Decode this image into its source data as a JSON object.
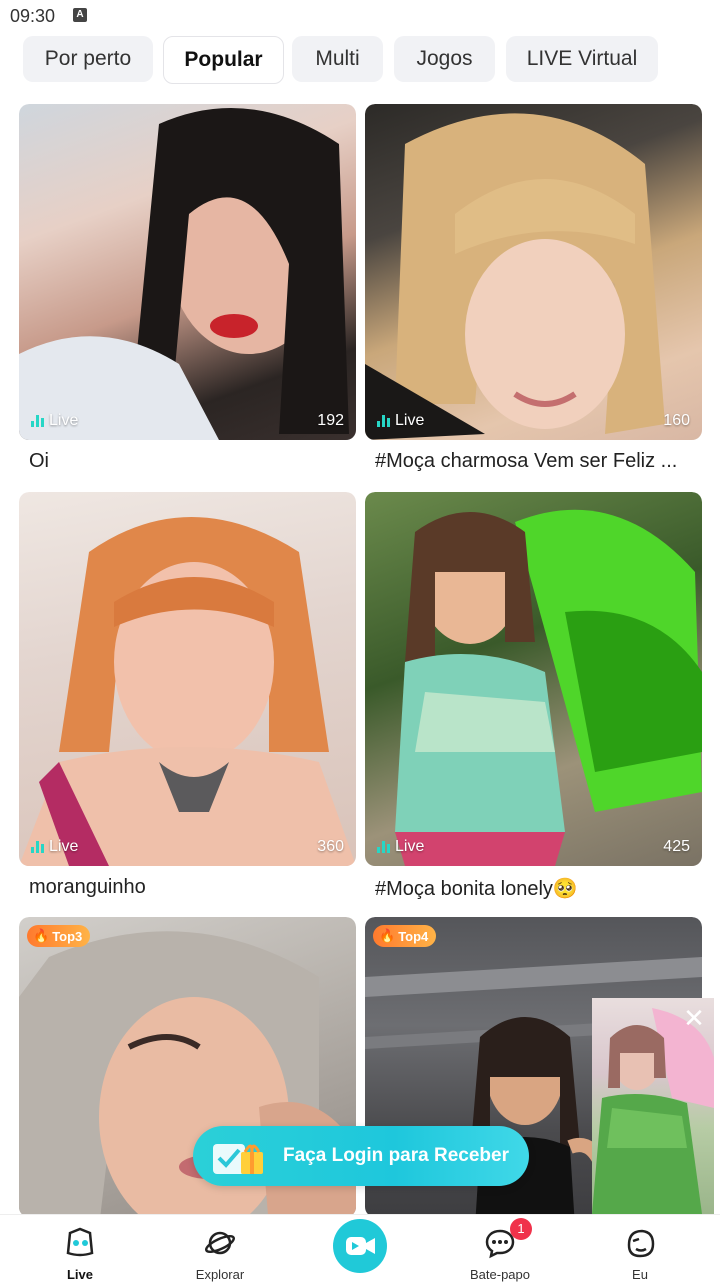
{
  "status": {
    "time": "09:30",
    "indicator": "A"
  },
  "tabs": [
    {
      "label": "Por perto"
    },
    {
      "label": "Popular"
    },
    {
      "label": "Multi"
    },
    {
      "label": "Jogos"
    },
    {
      "label": "LIVE Virtual"
    }
  ],
  "active_tab": "Popular",
  "cards": [
    {
      "live_label": "Live",
      "viewers": "192",
      "caption": "Oi",
      "badge": ""
    },
    {
      "live_label": "Live",
      "viewers": "160",
      "caption": "#Moça charmosa Vem ser Feliz ...",
      "badge": ""
    },
    {
      "live_label": "Live",
      "viewers": "360",
      "caption": "moranguinho",
      "badge": ""
    },
    {
      "live_label": "Live",
      "viewers": "425",
      "caption": "#Moça bonita lonely🥺",
      "badge": ""
    },
    {
      "live_label": "",
      "viewers": "",
      "caption": "",
      "badge": "Top3"
    },
    {
      "live_label": "",
      "viewers": "",
      "caption": "",
      "badge": "Top4"
    }
  ],
  "login_banner": {
    "text": "Faça Login para Receber"
  },
  "bottom_nav": [
    {
      "label": "Live",
      "icon": "live-icon"
    },
    {
      "label": "Explorar",
      "icon": "planet-icon"
    },
    {
      "label": "",
      "icon": "video-camera-icon"
    },
    {
      "label": "Bate-papo",
      "icon": "chat-bubble-icon",
      "badge": "1"
    },
    {
      "label": "Eu",
      "icon": "profile-icon"
    }
  ],
  "colors": {
    "accent": "#20c9d8",
    "live_bars": "#27d6c6",
    "badge_red": "#f0324b",
    "top_badge": "#ff8a33"
  }
}
